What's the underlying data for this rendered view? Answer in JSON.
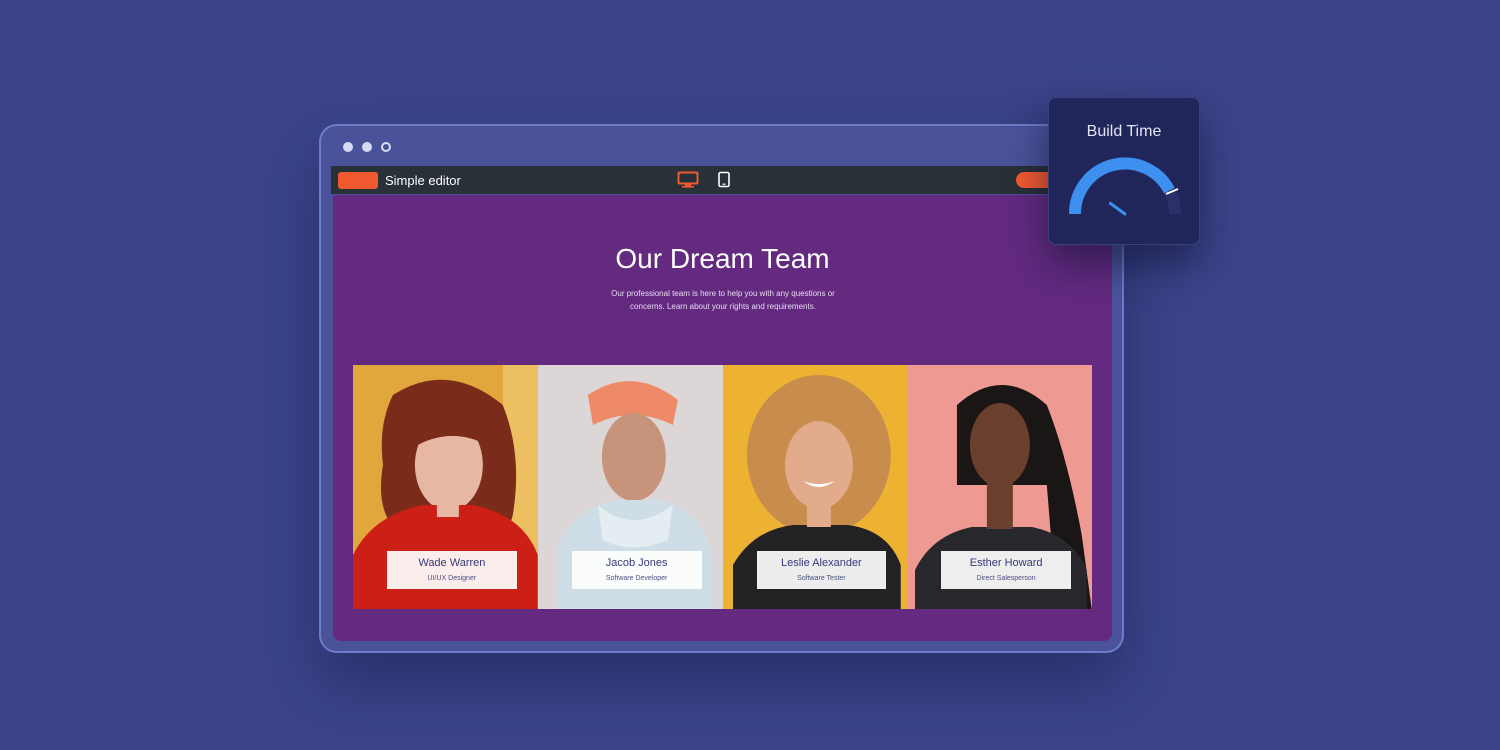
{
  "editor": {
    "title": "Simple editor",
    "accent_color": "#f15a31",
    "devices": [
      {
        "icon": "desktop-icon",
        "active": true
      },
      {
        "icon": "tablet-icon",
        "active": false
      }
    ]
  },
  "hero": {
    "title": "Our Dream Team",
    "subtitle": "Our professional team is here to help you with any questions or concerns. Learn about your rights and requirements."
  },
  "team": [
    {
      "name": "Wade Warren",
      "role": "UI/UX Designer",
      "background": "#e2a73c"
    },
    {
      "name": "Jacob Jones",
      "role": "Software Developer",
      "background": "#dcd6d6"
    },
    {
      "name": "Leslie Alexander",
      "role": "Software Tester",
      "background": "#edb232"
    },
    {
      "name": "Esther Howard",
      "role": "Direct Salesperson",
      "background": "#ee9a92"
    }
  ],
  "widget": {
    "title": "Build Time",
    "gauge_fraction": 0.2,
    "gauge_color": "#3d8ff0"
  }
}
